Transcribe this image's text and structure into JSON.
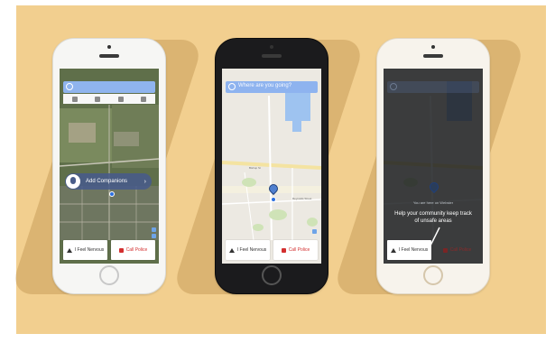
{
  "phones": [
    {
      "id": "phone-1",
      "search_placeholder": "",
      "companion_label": "Add Companions",
      "companion_chevron": "›",
      "report_label": "I Feel Nervous",
      "police_label": "Call Police"
    },
    {
      "id": "phone-2",
      "search_placeholder": "Where are you going?",
      "report_label": "I Feel Nervous",
      "police_label": "Call Police",
      "map_labels": [
        "Reynolds Street",
        "Bishop St"
      ]
    },
    {
      "id": "phone-3",
      "small_caption": "You are here on Webster",
      "help_text": "Help your community keep track of unsafe areas",
      "report_label": "I Feel Nervous",
      "police_label": "Call Police"
    }
  ],
  "colors": {
    "background": "#f2cf8f",
    "search_bar": "#8eb3ef",
    "police_red": "#d32f2f",
    "pin_blue": "#4f7fcf"
  }
}
